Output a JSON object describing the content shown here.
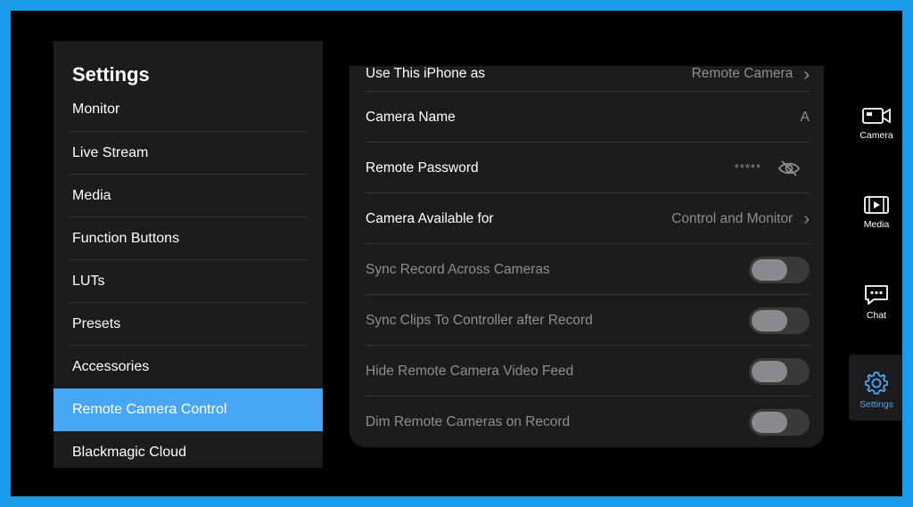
{
  "settings_panel": {
    "title": "Settings",
    "items": [
      {
        "label": "Monitor"
      },
      {
        "label": "Live Stream"
      },
      {
        "label": "Media"
      },
      {
        "label": "Function Buttons"
      },
      {
        "label": "LUTs"
      },
      {
        "label": "Presets"
      },
      {
        "label": "Accessories"
      },
      {
        "label": "Remote Camera Control",
        "active": true
      },
      {
        "label": "Blackmagic Cloud"
      }
    ]
  },
  "detail": {
    "use_iphone_as": {
      "label": "Use This iPhone as",
      "value": "Remote Camera"
    },
    "camera_name": {
      "label": "Camera Name",
      "value": "A"
    },
    "remote_password": {
      "label": "Remote Password",
      "value": "*****"
    },
    "camera_available_for": {
      "label": "Camera Available for",
      "value": "Control and Monitor"
    },
    "sync_record": {
      "label": "Sync Record Across Cameras",
      "on": false
    },
    "sync_clips": {
      "label": "Sync Clips To Controller after Record",
      "on": false
    },
    "hide_feed": {
      "label": "Hide Remote Camera Video Feed",
      "on": false
    },
    "dim_remote": {
      "label": "Dim Remote Cameras on Record",
      "on": false
    }
  },
  "side_nav": {
    "camera": "Camera",
    "media": "Media",
    "chat": "Chat",
    "settings": "Settings"
  },
  "colors": {
    "frame": "#1a9bea",
    "active_item": "#48a7f2",
    "active_nav": "#4aa8f5"
  }
}
